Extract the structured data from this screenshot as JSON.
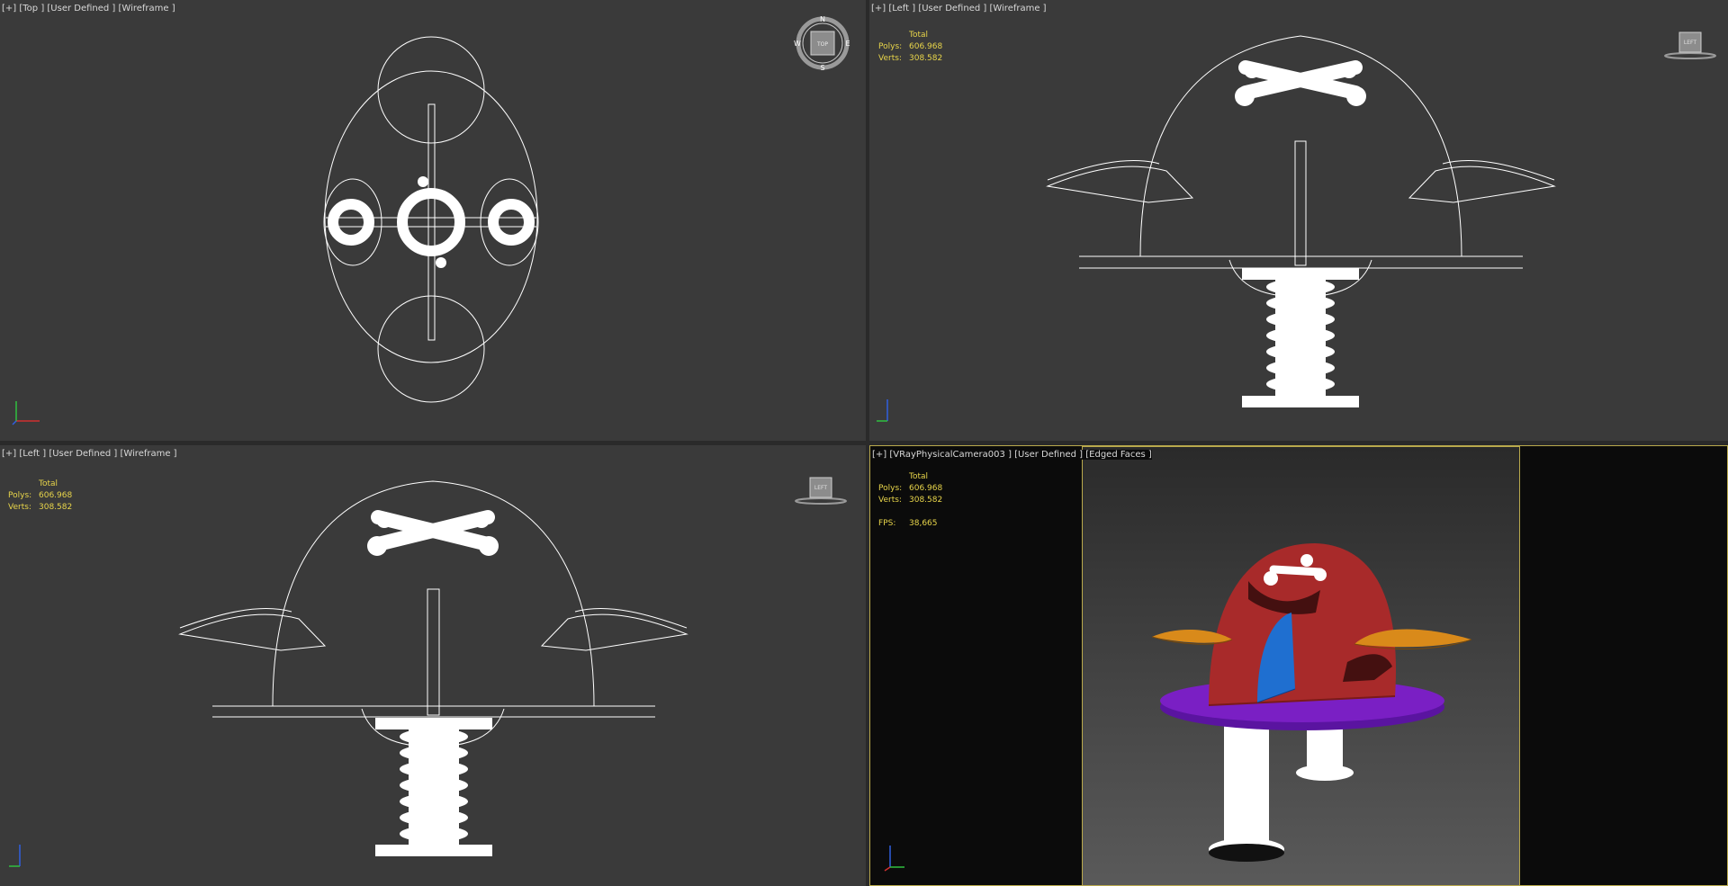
{
  "viewports": {
    "top": {
      "label": "[+] [Top ] [User Defined ] [Wireframe ]",
      "compass": {
        "n": "N",
        "s": "S",
        "e": "E",
        "w": "W",
        "cube_face": "TOP"
      }
    },
    "left_top": {
      "label": "[+] [Left ] [User Defined ] [Wireframe ]",
      "stats": {
        "total": "Total",
        "polys_label": "Polys:",
        "polys": "606.968",
        "verts_label": "Verts:",
        "verts": "308.582"
      },
      "cube_face": "LEFT"
    },
    "left_bottom": {
      "label": "[+] [Left ] [User Defined ] [Wireframe ]",
      "stats": {
        "total": "Total",
        "polys_label": "Polys:",
        "polys": "606.968",
        "verts_label": "Verts:",
        "verts": "308.582"
      },
      "cube_face": "LEFT"
    },
    "camera": {
      "label": "[+] [VRayPhysicalCamera003 ] [User Defined ] [Edged Faces ]",
      "stats": {
        "total": "Total",
        "polys_label": "Polys:",
        "polys": "606.968",
        "verts_label": "Verts:",
        "verts": "308.582",
        "fps_label": "FPS:",
        "fps": "38,665"
      }
    }
  },
  "colors": {
    "viewport_bg": "#3a3a3a",
    "wire": "#ffffff",
    "stats_text": "#e8d54a",
    "active_border": "#b9a94c",
    "seat_red": "#a82a2a",
    "base_purple": "#7a1fc4",
    "handle_orange": "#d98a1a",
    "fin_blue": "#1f6fd0"
  }
}
